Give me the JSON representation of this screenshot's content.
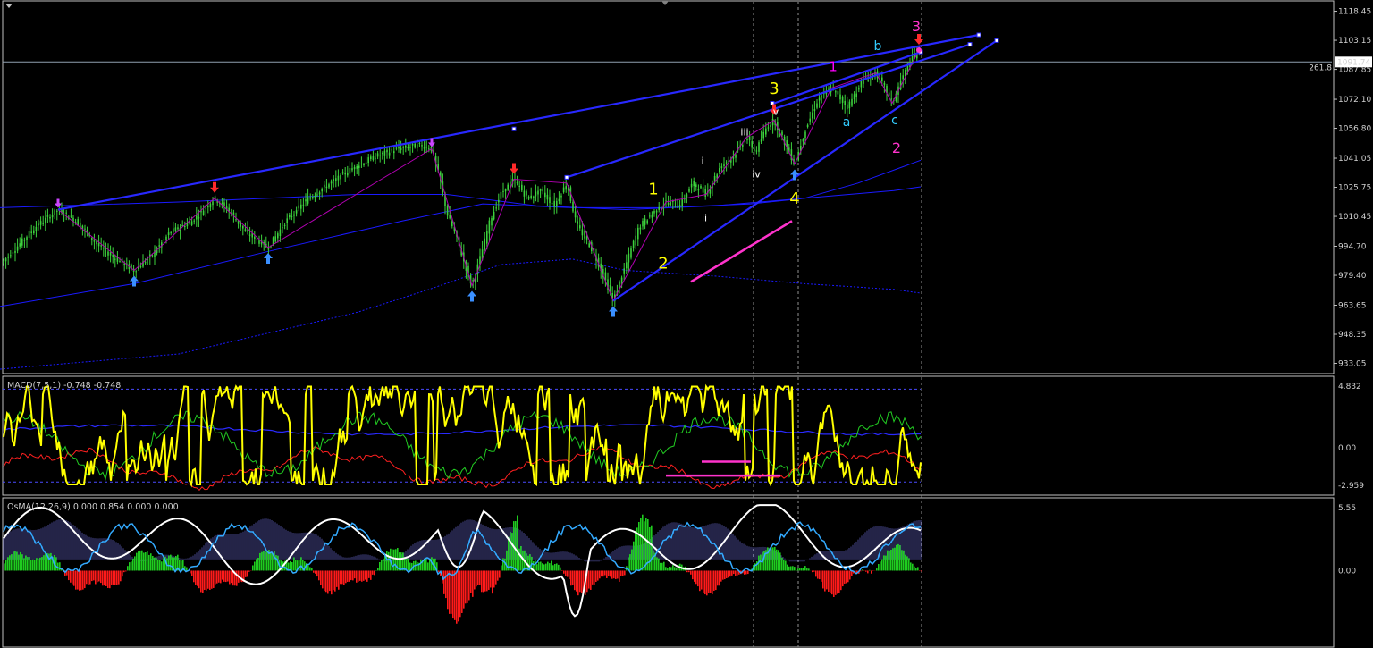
{
  "chart_data": [
    {
      "type": "line",
      "pane": "price",
      "ylim": [
        930,
        1122
      ],
      "y_ticks": [
        "1118.45",
        "1103.15",
        "1087.85",
        "1072.10",
        "1056.80",
        "1041.05",
        "1025.75",
        "1010.45",
        "994.70",
        "979.40",
        "963.65",
        "948.35",
        "933.05"
      ],
      "current_price_label": "1091.74",
      "fib_label": "261.8",
      "price_path": [
        [
          0,
          985
        ],
        [
          20,
          995
        ],
        [
          40,
          1005
        ],
        [
          65,
          1014
        ],
        [
          85,
          1008
        ],
        [
          110,
          995
        ],
        [
          130,
          988
        ],
        [
          150,
          982
        ],
        [
          170,
          990
        ],
        [
          190,
          1002
        ],
        [
          215,
          1008
        ],
        [
          240,
          1020
        ],
        [
          255,
          1014
        ],
        [
          275,
          1002
        ],
        [
          300,
          994
        ],
        [
          320,
          1008
        ],
        [
          345,
          1020
        ],
        [
          370,
          1028
        ],
        [
          395,
          1036
        ],
        [
          420,
          1042
        ],
        [
          445,
          1046
        ],
        [
          470,
          1048
        ],
        [
          483,
          1046
        ],
        [
          492,
          1030
        ],
        [
          500,
          1012
        ],
        [
          510,
          1000
        ],
        [
          520,
          985
        ],
        [
          528,
          974
        ],
        [
          538,
          990
        ],
        [
          548,
          1008
        ],
        [
          560,
          1022
        ],
        [
          575,
          1030
        ],
        [
          590,
          1020
        ],
        [
          605,
          1024
        ],
        [
          620,
          1016
        ],
        [
          634,
          1028
        ],
        [
          645,
          1006
        ],
        [
          660,
          995
        ],
        [
          672,
          983
        ],
        [
          686,
          966
        ],
        [
          700,
          985
        ],
        [
          715,
          1005
        ],
        [
          730,
          1012
        ],
        [
          745,
          1018
        ],
        [
          760,
          1016
        ],
        [
          775,
          1028
        ],
        [
          790,
          1022
        ],
        [
          805,
          1036
        ],
        [
          820,
          1042
        ],
        [
          835,
          1052
        ],
        [
          845,
          1044
        ],
        [
          858,
          1058
        ],
        [
          866,
          1061
        ],
        [
          875,
          1052
        ],
        [
          889,
          1038
        ],
        [
          900,
          1055
        ],
        [
          915,
          1072
        ],
        [
          930,
          1078
        ],
        [
          948,
          1068
        ],
        [
          965,
          1082
        ],
        [
          980,
          1086
        ],
        [
          992,
          1076
        ],
        [
          998,
          1070
        ],
        [
          1008,
          1082
        ],
        [
          1018,
          1092
        ],
        [
          1028,
          1098
        ]
      ],
      "ma_upper": [
        [
          0,
          1015
        ],
        [
          200,
          1018
        ],
        [
          400,
          1022
        ],
        [
          500,
          1022
        ],
        [
          600,
          1016
        ],
        [
          700,
          1014
        ],
        [
          800,
          1016
        ],
        [
          900,
          1020
        ],
        [
          1000,
          1024
        ],
        [
          1030,
          1026
        ]
      ],
      "ma_mid": [
        [
          0,
          963
        ],
        [
          150,
          975
        ],
        [
          300,
          992
        ],
        [
          450,
          1008
        ],
        [
          540,
          1017
        ],
        [
          640,
          1015
        ],
        [
          740,
          1015
        ],
        [
          840,
          1017
        ],
        [
          900,
          1020
        ],
        [
          960,
          1028
        ],
        [
          1030,
          1040
        ]
      ],
      "ma_lower": [
        [
          0,
          930
        ],
        [
          200,
          938
        ],
        [
          400,
          960
        ],
        [
          480,
          972
        ],
        [
          560,
          985
        ],
        [
          640,
          988
        ],
        [
          700,
          982
        ],
        [
          800,
          979
        ],
        [
          900,
          975
        ],
        [
          1000,
          972
        ],
        [
          1030,
          970
        ]
      ],
      "fractal_line": [
        [
          65,
          1014
        ],
        [
          150,
          982
        ],
        [
          240,
          1020
        ],
        [
          300,
          994
        ],
        [
          483,
          1046
        ],
        [
          528,
          974
        ],
        [
          575,
          1030
        ],
        [
          634,
          1028
        ],
        [
          686,
          966
        ],
        [
          745,
          1018
        ],
        [
          790,
          1022
        ],
        [
          835,
          1052
        ],
        [
          866,
          1061
        ],
        [
          889,
          1038
        ],
        [
          930,
          1078
        ],
        [
          980,
          1086
        ],
        [
          998,
          1070
        ],
        [
          1028,
          1098
        ]
      ],
      "trendlines": [
        {
          "from": [
            65,
            1014
          ],
          "to": [
            1095,
            1106
          ]
        },
        {
          "from": [
            634,
            1031
          ],
          "to": [
            1085,
            1101
          ]
        },
        {
          "from": [
            686,
            966
          ],
          "to": [
            1115,
            1103
          ]
        },
        {
          "from": [
            866,
            1070
          ],
          "to": [
            1030,
            1097
          ]
        }
      ],
      "magenta_segment": {
        "from": [
          773,
          976
        ],
        "to": [
          886,
          1008
        ]
      },
      "arrows_up": [
        [
          150,
          982
        ],
        [
          300,
          994
        ],
        [
          528,
          974
        ],
        [
          686,
          966
        ],
        [
          889,
          1038
        ]
      ],
      "arrows_down": [
        [
          240,
          1020
        ],
        [
          575,
          1030
        ],
        [
          866,
          1061
        ],
        [
          1028,
          1098
        ]
      ],
      "arrows_violet": [
        [
          65,
          1014
        ],
        [
          483,
          1046
        ]
      ],
      "wave_labels": [
        {
          "t": "1",
          "x": 731,
          "y": 1022,
          "color": "#ffff00",
          "size": 18
        },
        {
          "t": "2",
          "x": 742,
          "y": 983,
          "color": "#ffff00",
          "size": 18
        },
        {
          "t": "3",
          "x": 866,
          "y": 1075,
          "color": "#ffff00",
          "size": 18
        },
        {
          "t": "4",
          "x": 889,
          "y": 1017,
          "color": "#ffff00",
          "size": 18
        },
        {
          "t": "i",
          "x": 786,
          "y": 1038,
          "color": "#ffffff",
          "size": 11
        },
        {
          "t": "ii",
          "x": 788,
          "y": 1008,
          "color": "#ffffff",
          "size": 11
        },
        {
          "t": "iii",
          "x": 833,
          "y": 1053,
          "color": "#ffffff",
          "size": 11
        },
        {
          "t": "iv",
          "x": 846,
          "y": 1031,
          "color": "#ffffff",
          "size": 11
        },
        {
          "t": "v",
          "x": 868,
          "y": 1064,
          "color": "#ffffff",
          "size": 11
        },
        {
          "t": "1",
          "x": 932,
          "y": 1087,
          "color": "#ff00ff",
          "size": 15
        },
        {
          "t": "a",
          "x": 947,
          "y": 1058,
          "color": "#33ccff",
          "size": 14
        },
        {
          "t": "b",
          "x": 982,
          "y": 1098,
          "color": "#33ccff",
          "size": 14
        },
        {
          "t": "c",
          "x": 1001,
          "y": 1059,
          "color": "#33ccff",
          "size": 14
        },
        {
          "t": "2",
          "x": 1003,
          "y": 1044,
          "color": "#ff33cc",
          "size": 16
        },
        {
          "t": "3",
          "x": 1025,
          "y": 1108,
          "color": "#ff33cc",
          "size": 16
        }
      ],
      "vlines_x": [
        843,
        893,
        1031
      ]
    },
    {
      "type": "line",
      "pane": "macd",
      "title": "MACD(7,5,1) -0.748 -0.748",
      "ylim": [
        -3.6,
        5.4
      ],
      "y_ticks": [
        "4.832",
        "0.00",
        "-2.959"
      ],
      "upper_band": 4.6,
      "lower_band": -2.7,
      "zero_line": 0,
      "magenta_segments": [
        {
          "from": [
            745,
            -2.2
          ],
          "to": [
            873,
            -2.2
          ]
        },
        {
          "from": [
            785,
            -1.1
          ],
          "to": [
            840,
            -1.1
          ]
        }
      ]
    },
    {
      "type": "line",
      "pane": "osma",
      "title": "OsMA(12,26,9) 0.000 0.854 0.000 0.000",
      "ylim": [
        -6.6,
        6.2
      ],
      "y_ticks": [
        "5.55",
        "0.00"
      ],
      "zero_line": 0
    }
  ],
  "colors": {
    "background": "#000000",
    "candles": "#3cd23c",
    "ma_line": "#1a1aff",
    "trendline": "#2828ff",
    "fractal": "#b000b0",
    "macd_main": "#ffff00",
    "macd_green": "#22cc22",
    "macd_red": "#ff2020",
    "macd_blue": "#2a2aff",
    "osma_pos": "#1fcc1f",
    "osma_neg": "#ff1a1a",
    "osma_white": "#ffffff",
    "osma_cyan": "#33aaff",
    "osma_hatch": "#8080ff",
    "magenta": "#ff33cc",
    "axis_text": "#d0d0d0",
    "panel_border": "#c0c0c0"
  }
}
